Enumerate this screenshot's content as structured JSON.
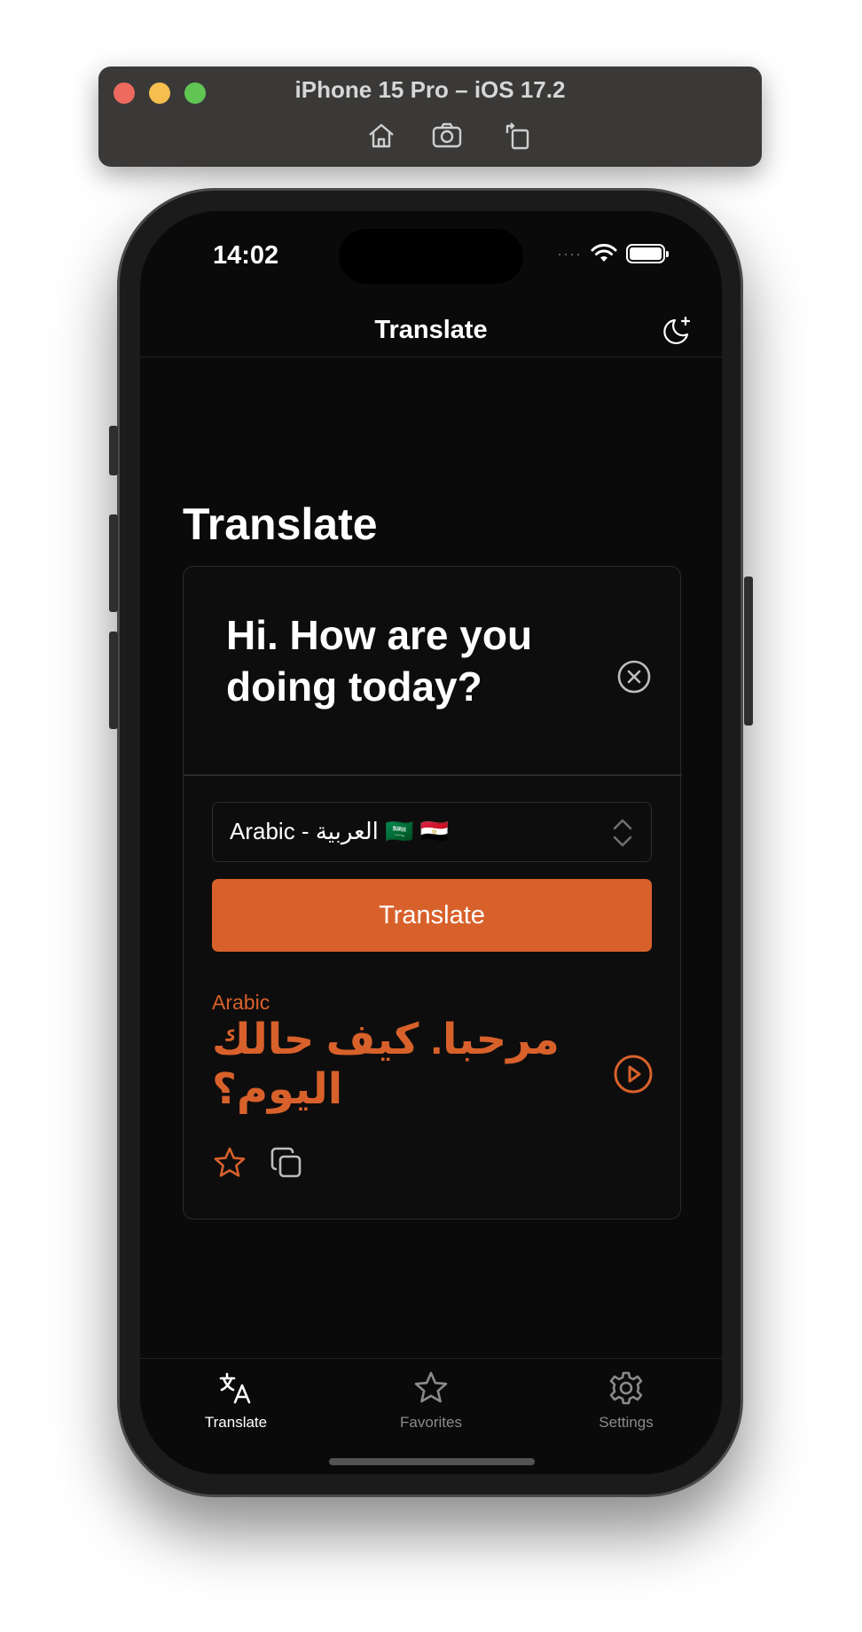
{
  "simulator": {
    "title": "iPhone 15 Pro – iOS 17.2",
    "tools": [
      "home-icon",
      "screenshot-icon",
      "rotate-icon"
    ]
  },
  "status_bar": {
    "time": "14:02",
    "signal": "····"
  },
  "nav": {
    "title": "Translate",
    "theme_icon": "moon-sparkle-icon"
  },
  "page": {
    "title": "Translate"
  },
  "input": {
    "text": "Hi. How are you doing today?",
    "clear_icon": "clear-circle-icon"
  },
  "language_select": {
    "selected": "Arabic - العربية 🇸🇦 🇪🇬"
  },
  "translate_button": {
    "label": "Translate"
  },
  "output": {
    "language": "Arabic",
    "text": "مرحبا. كيف حالك اليوم؟"
  },
  "tabs": [
    {
      "label": "Translate",
      "icon": "translate-icon",
      "active": true
    },
    {
      "label": "Favorites",
      "icon": "star-icon",
      "active": false
    },
    {
      "label": "Settings",
      "icon": "gear-icon",
      "active": false
    }
  ],
  "colors": {
    "accent": "#d8612b",
    "background": "#0b0a0a",
    "card_border": "#2c2b2b"
  }
}
